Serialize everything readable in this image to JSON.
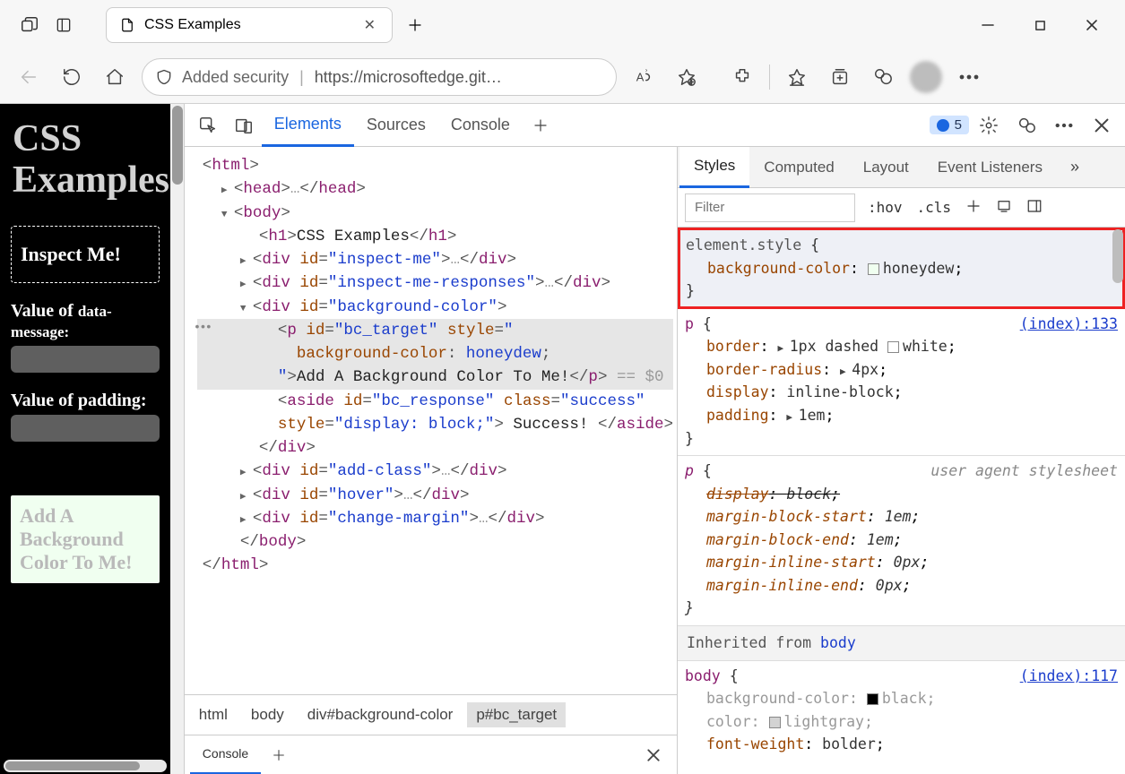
{
  "browser": {
    "tab_title": "CSS Examples",
    "address": {
      "security_label": "Added security",
      "url": "https://microsoftedge.git…"
    }
  },
  "page": {
    "heading": "CSS Examples",
    "inspect_box": "Inspect Me!",
    "value_data_message": "Value of data-message:",
    "value_padding": "Value of padding:",
    "add_bg_text": "Add A Background Color To Me!"
  },
  "devtools": {
    "tabs": [
      "Elements",
      "Sources",
      "Console"
    ],
    "active_tab": "Elements",
    "issues_count": "5",
    "breadcrumb": [
      "html",
      "body",
      "div#background-color",
      "p#bc_target"
    ],
    "drawer_tab": "Console",
    "dom": {
      "html_open": "html",
      "head": "head",
      "body": "body",
      "h1_text": "CSS Examples",
      "div_inspect_me": "inspect-me",
      "div_inspect_me_resp": "inspect-me-responses",
      "div_bg": "background-color",
      "p_id": "bc_target",
      "p_style_prop": "background-color",
      "p_style_val": "honeydew",
      "p_text": "Add A Background Color To Me!",
      "dollar0": "== $0",
      "aside_id": "bc_response",
      "aside_class": "success",
      "aside_style": "display: block;",
      "aside_text": " Success! ",
      "div_add_class": "add-class",
      "div_hover": "hover",
      "div_change_margin": "change-margin"
    }
  },
  "styles": {
    "tabs": [
      "Styles",
      "Computed",
      "Layout",
      "Event Listeners"
    ],
    "filter_placeholder": "Filter",
    "hov": ":hov",
    "cls": ".cls",
    "rules": {
      "element_style": {
        "selector": "element.style",
        "bg_prop": "background-color",
        "bg_val": "honeydew"
      },
      "p_rule": {
        "selector": "p",
        "link": "(index):133",
        "border": {
          "prop": "border",
          "val": "1px dashed ",
          "color": "white"
        },
        "radius": {
          "prop": "border-radius",
          "val": "4px"
        },
        "display": {
          "prop": "display",
          "val": "inline-block"
        },
        "padding": {
          "prop": "padding",
          "val": "1em"
        }
      },
      "p_ua": {
        "selector": "p",
        "label": "user agent stylesheet",
        "display": {
          "prop": "display",
          "val": "block"
        },
        "mbs": {
          "prop": "margin-block-start",
          "val": "1em"
        },
        "mbe": {
          "prop": "margin-block-end",
          "val": "1em"
        },
        "mis": {
          "prop": "margin-inline-start",
          "val": "0px"
        },
        "mie": {
          "prop": "margin-inline-end",
          "val": "0px"
        }
      },
      "inherited_label": "Inherited from ",
      "inherited_from": "body",
      "body_rule": {
        "selector": "body",
        "link": "(index):117",
        "bg": {
          "prop": "background-color",
          "val": "black"
        },
        "color": {
          "prop": "color",
          "val": "lightgray"
        },
        "fw": {
          "prop": "font-weight",
          "val": "bolder"
        }
      }
    }
  }
}
